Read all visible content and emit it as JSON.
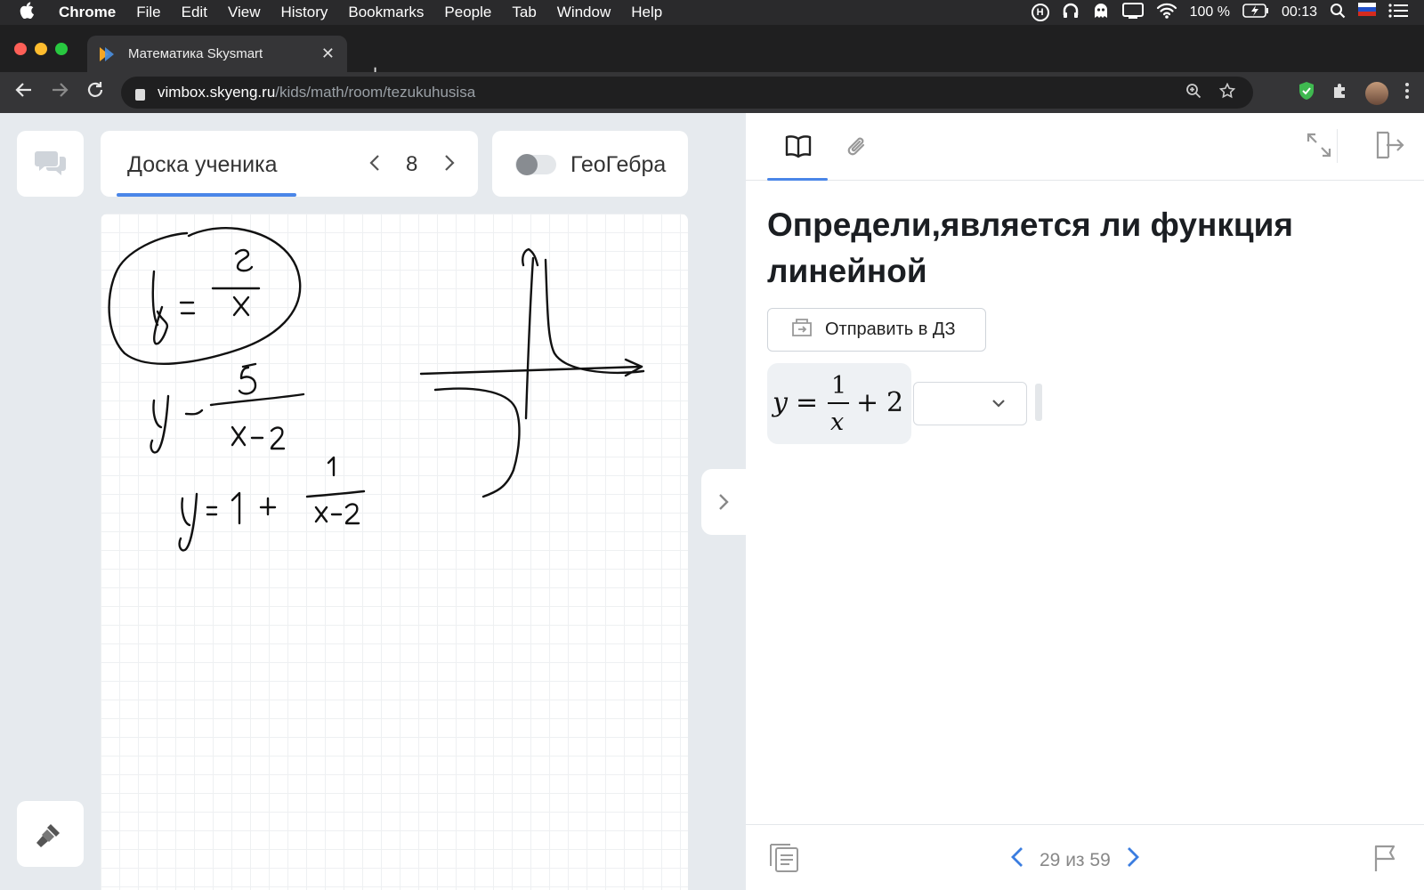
{
  "menubar": {
    "app": "Chrome",
    "items": [
      "File",
      "Edit",
      "View",
      "History",
      "Bookmarks",
      "People",
      "Tab",
      "Window",
      "Help"
    ],
    "battery": "100 %",
    "time": "00:13"
  },
  "browser": {
    "tab_title": "Математика Skysmart",
    "url_host": "vimbox.skyeng.ru",
    "url_path": "/kids/math/room/tezukuhusisa"
  },
  "board_header": {
    "title": "Доска ученика",
    "page": "8",
    "geogebra_label": "ГеоГебра"
  },
  "task": {
    "title": "Определи,является ли функция линейной",
    "send_button": "Отправить в ДЗ"
  },
  "pager": {
    "text": "29 из 59"
  },
  "colors": {
    "accent": "#4a86e8",
    "pager_arrow": "#3b7de0"
  }
}
